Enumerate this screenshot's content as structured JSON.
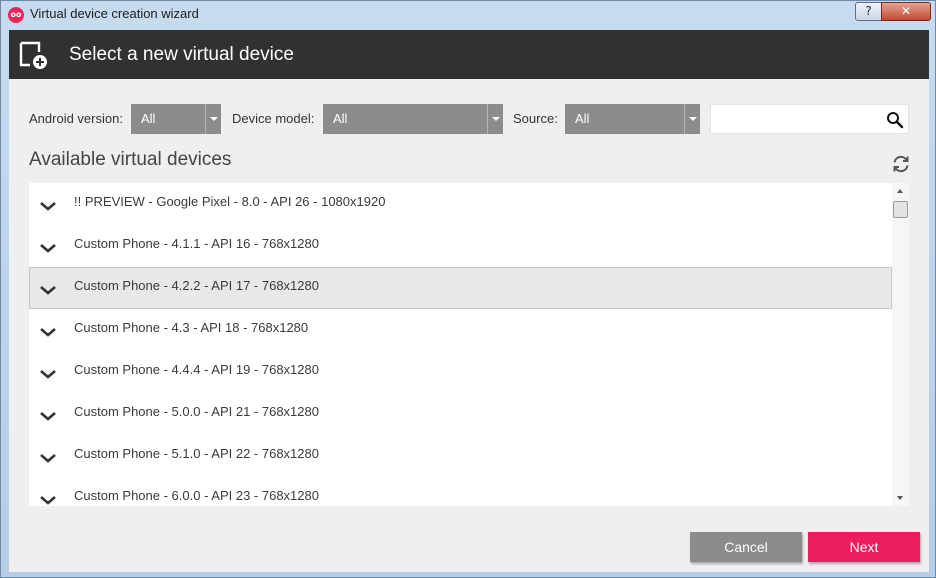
{
  "window": {
    "title": "Virtual device creation wizard",
    "app_icon_glyph": "oo",
    "help_glyph": "?",
    "close_glyph": "✕"
  },
  "header": {
    "title": "Select a new virtual device",
    "icon": "add-device-icon"
  },
  "filters": {
    "android_version": {
      "label": "Android version:",
      "value": "All"
    },
    "device_model": {
      "label": "Device model:",
      "value": "All"
    },
    "source": {
      "label": "Source:",
      "value": "All"
    },
    "search": {
      "value": "",
      "placeholder": ""
    }
  },
  "list": {
    "title": "Available virtual devices",
    "selected_index": 2,
    "items": [
      {
        "label": "!! PREVIEW - Google Pixel - 8.0 - API 26 - 1080x1920"
      },
      {
        "label": "Custom Phone - 4.1.1 - API 16 - 768x1280"
      },
      {
        "label": "Custom Phone - 4.2.2 - API 17 - 768x1280"
      },
      {
        "label": "Custom Phone - 4.3 - API 18 - 768x1280"
      },
      {
        "label": "Custom Phone - 4.4.4 - API 19 - 768x1280"
      },
      {
        "label": "Custom Phone - 5.0.0 - API 21 - 768x1280"
      },
      {
        "label": "Custom Phone - 5.1.0 - API 22 - 768x1280"
      },
      {
        "label": "Custom Phone - 6.0.0 - API 23 - 768x1280"
      }
    ]
  },
  "buttons": {
    "cancel": "Cancel",
    "next": "Next"
  },
  "colors": {
    "header_bg": "#313131",
    "accent": "#ec1d5e",
    "select_bg": "#8c8c8c"
  }
}
